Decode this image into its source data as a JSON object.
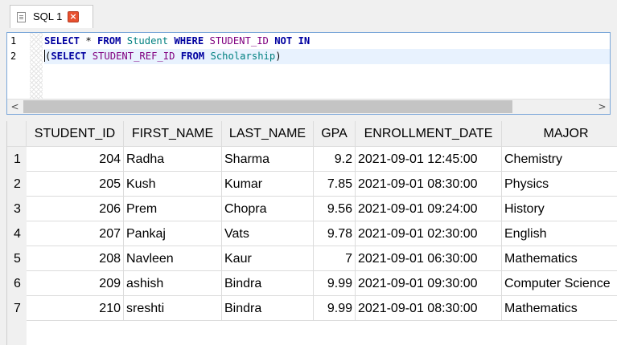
{
  "tab": {
    "label": "SQL 1",
    "close_icon": "close-icon"
  },
  "editor": {
    "lines": [
      {
        "number": "1",
        "tokens": [
          {
            "t": "SELECT",
            "c": "kw"
          },
          {
            "t": " * ",
            "c": "txt"
          },
          {
            "t": "FROM",
            "c": "kw"
          },
          {
            "t": " ",
            "c": "txt"
          },
          {
            "t": "Student",
            "c": "tbl"
          },
          {
            "t": " ",
            "c": "txt"
          },
          {
            "t": "WHERE",
            "c": "kw"
          },
          {
            "t": " ",
            "c": "txt"
          },
          {
            "t": "STUDENT_ID",
            "c": "col"
          },
          {
            "t": " ",
            "c": "txt"
          },
          {
            "t": "NOT",
            "c": "kw"
          },
          {
            "t": " ",
            "c": "txt"
          },
          {
            "t": "IN",
            "c": "kw"
          }
        ]
      },
      {
        "number": "2",
        "tokens": [
          {
            "t": "(",
            "c": "txt"
          },
          {
            "t": "SELECT",
            "c": "kw"
          },
          {
            "t": " ",
            "c": "txt"
          },
          {
            "t": "STUDENT_REF_ID",
            "c": "col"
          },
          {
            "t": " ",
            "c": "txt"
          },
          {
            "t": "FROM",
            "c": "kw"
          },
          {
            "t": " ",
            "c": "txt"
          },
          {
            "t": "Scholarship",
            "c": "tbl"
          },
          {
            "t": ")",
            "c": "txt"
          }
        ]
      }
    ],
    "scroll_left": "<",
    "scroll_right": ">"
  },
  "results": {
    "columns": [
      "STUDENT_ID",
      "FIRST_NAME",
      "LAST_NAME",
      "GPA",
      "ENROLLMENT_DATE",
      "MAJOR"
    ],
    "rows": [
      {
        "n": "1",
        "cells": [
          "204",
          "Radha",
          "Sharma",
          "9.2",
          "2021-09-01 12:45:00",
          "Chemistry"
        ]
      },
      {
        "n": "2",
        "cells": [
          "205",
          "Kush",
          "Kumar",
          "7.85",
          "2021-09-01 08:30:00",
          "Physics"
        ]
      },
      {
        "n": "3",
        "cells": [
          "206",
          "Prem",
          "Chopra",
          "9.56",
          "2021-09-01 09:24:00",
          "History"
        ]
      },
      {
        "n": "4",
        "cells": [
          "207",
          "Pankaj",
          "Vats",
          "9.78",
          "2021-09-01 02:30:00",
          "English"
        ]
      },
      {
        "n": "5",
        "cells": [
          "208",
          "Navleen",
          "Kaur",
          "7",
          "2021-09-01 06:30:00",
          "Mathematics"
        ]
      },
      {
        "n": "6",
        "cells": [
          "209",
          "ashish",
          "Bindra",
          "9.99",
          "2021-09-01 09:30:00",
          "Computer Science"
        ]
      },
      {
        "n": "7",
        "cells": [
          "210",
          "sreshti",
          "Bindra",
          "9.99",
          "2021-09-01 08:30:00",
          "Mathematics"
        ]
      }
    ]
  }
}
